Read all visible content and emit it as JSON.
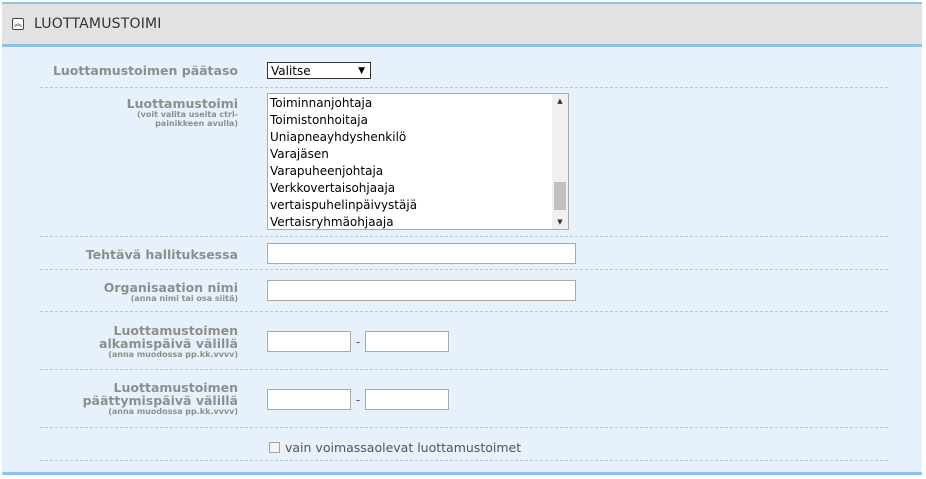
{
  "section": {
    "title": "LUOTTAMUSTOIMI",
    "collapse_icon": "chevrons-up-icon"
  },
  "form": {
    "level": {
      "label": "Luottamustoimen päätaso",
      "value": "Valitse"
    },
    "position": {
      "label": "Luottamustoimi",
      "hint": "(voit valita useita ctrl-painikkeen avulla)",
      "options": [
        "Toiminnanjohtaja",
        "Toimistonhoitaja",
        "Uniapneayhdyshenkilö",
        "Varajäsen",
        "Varapuheenjohtaja",
        "Verkkovertaisohjaaja",
        "vertaispuhelinpäivystäjä",
        "Vertaisryhmäohjaaja"
      ]
    },
    "board_task": {
      "label": "Tehtävä hallituksessa",
      "value": ""
    },
    "org_name": {
      "label": "Organisaation nimi",
      "hint": "(anna nimi tai osa siitä)",
      "value": ""
    },
    "start_date": {
      "label_line1": "Luottamustoimen",
      "label_line2": "alkamispäivä välillä",
      "hint": "(anna muodossa pp.kk.vvvv)",
      "separator": "-",
      "from": "",
      "to": ""
    },
    "end_date": {
      "label_line1": "Luottamustoimen",
      "label_line2": "päättymispäivä välillä",
      "hint": "(anna muodossa pp.kk.vvvv)",
      "separator": "-",
      "from": "",
      "to": ""
    },
    "active_only": {
      "label": "vain voimassaolevat luottamustoimet",
      "checked": false
    }
  },
  "colors": {
    "accent": "#8dc3ea",
    "panel_bg": "#e6f1fb",
    "header_bg": "#e2e2e2",
    "label": "#8e8e8e"
  }
}
